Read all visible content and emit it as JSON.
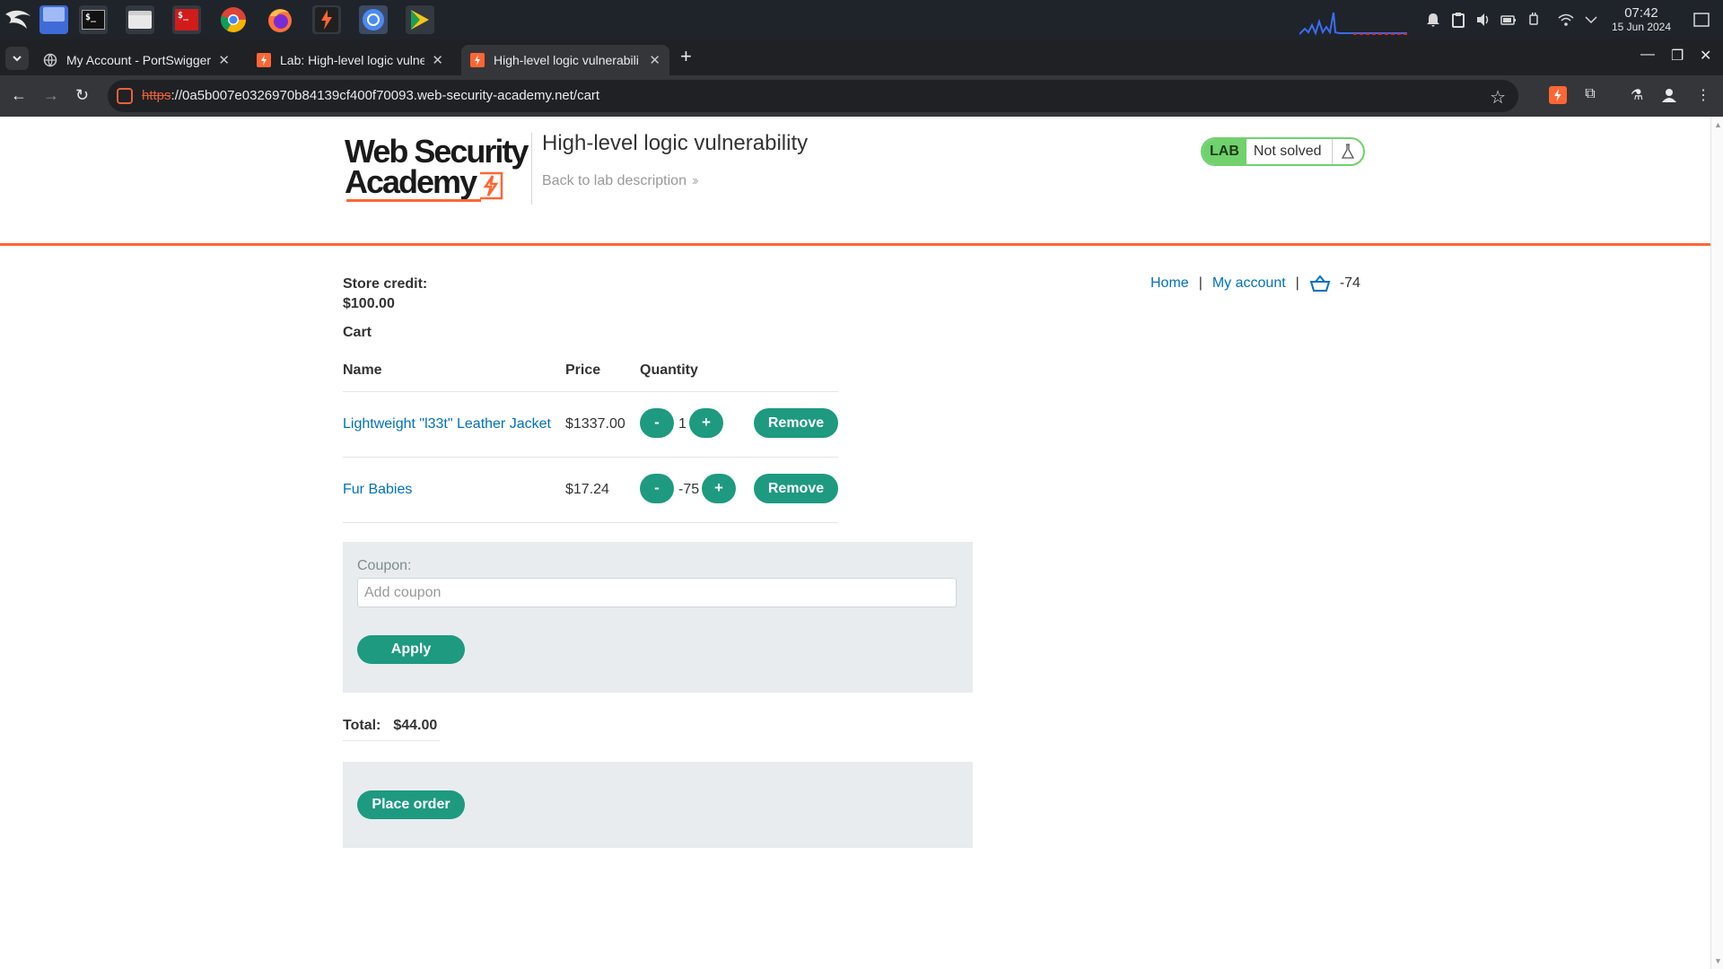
{
  "os": {
    "clock_time": "07:42",
    "clock_date": "15 Jun 2024"
  },
  "browser": {
    "tabs": [
      {
        "title": "My Account - PortSwigger",
        "active": false
      },
      {
        "title": "Lab: High-level logic vulner",
        "active": false
      },
      {
        "title": "High-level logic vulnerabili",
        "active": true
      }
    ],
    "url_scheme": "https",
    "url_rest": "://0a5b007e0326970b84139cf400f70093.web-security-academy.net/cart"
  },
  "header": {
    "logo_line1": "Web Security",
    "logo_line2": "Academy",
    "lab_title": "High-level logic vulnerability",
    "back_link": "Back to lab description",
    "lab_badge": "LAB",
    "lab_status": "Not solved"
  },
  "nav": {
    "home": "Home",
    "sep1": "|",
    "my_account": "My account",
    "sep2": "|",
    "cart_count": "-74"
  },
  "store": {
    "credit_label": "Store credit:",
    "credit_value": "$100.00",
    "cart_heading": "Cart"
  },
  "cart": {
    "columns": [
      "Name",
      "Price",
      "Quantity"
    ],
    "items": [
      {
        "name": "Lightweight \"l33t\" Leather Jacket",
        "price": "$1337.00",
        "quantity": "1"
      },
      {
        "name": "Fur Babies",
        "price": "$17.24",
        "quantity": "-75"
      }
    ],
    "minus_label": "-",
    "plus_label": "+",
    "remove_label": "Remove"
  },
  "coupon": {
    "label": "Coupon:",
    "placeholder": "Add coupon",
    "apply_label": "Apply"
  },
  "totals": {
    "label": "Total:",
    "value": "$44.00"
  },
  "order": {
    "place_label": "Place order"
  },
  "colors": {
    "accent_orange": "#ff6633",
    "button_green": "#1d9a80",
    "link_blue": "#0071bc",
    "lab_green": "#70d16d"
  }
}
